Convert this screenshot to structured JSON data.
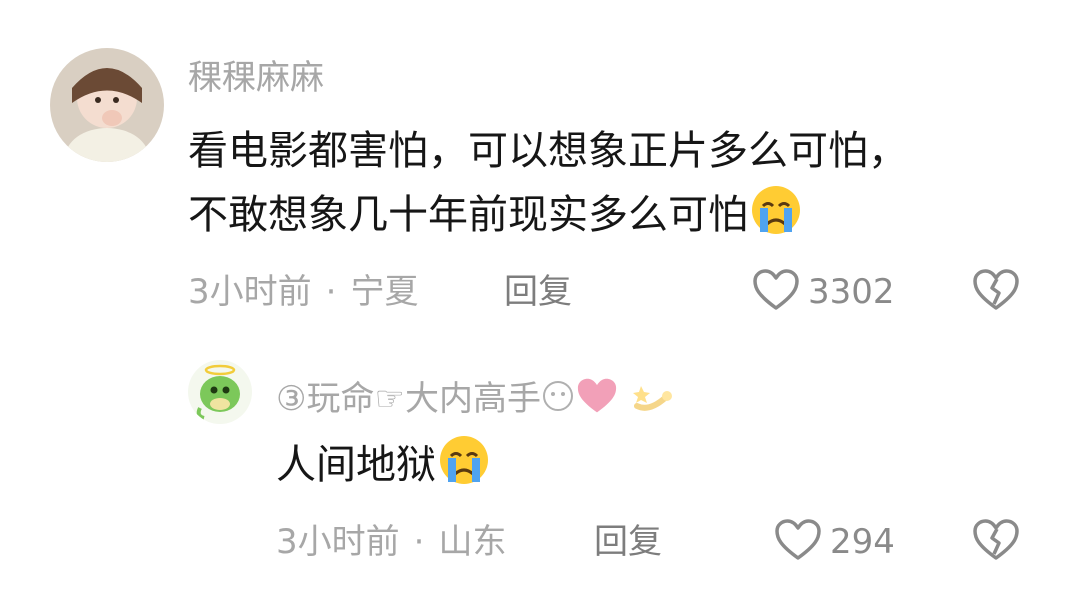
{
  "comments": [
    {
      "username": "稞稞麻麻",
      "text_line1": "看电影都害怕，可以想象正片多么可怕，",
      "text_line2": "不敢想象几十年前现实多么可怕",
      "time": "3小时前",
      "location": "宁夏",
      "reply_label": "回复",
      "like_count": "3302"
    },
    {
      "username_prefix": "③",
      "username_main": "玩命☞大内高手",
      "text": "人间地狱",
      "time": "3小时前",
      "location": "山东",
      "reply_label": "回复",
      "like_count": "294"
    }
  ],
  "separator": "·",
  "icons": {
    "like": "heart-outline-icon",
    "dislike": "broken-heart-icon",
    "emoji": "loudly-crying-face-emoji"
  },
  "colors": {
    "meta": "#a7a7a7",
    "text": "#161616",
    "heart_pink": "#f2a0b8"
  }
}
